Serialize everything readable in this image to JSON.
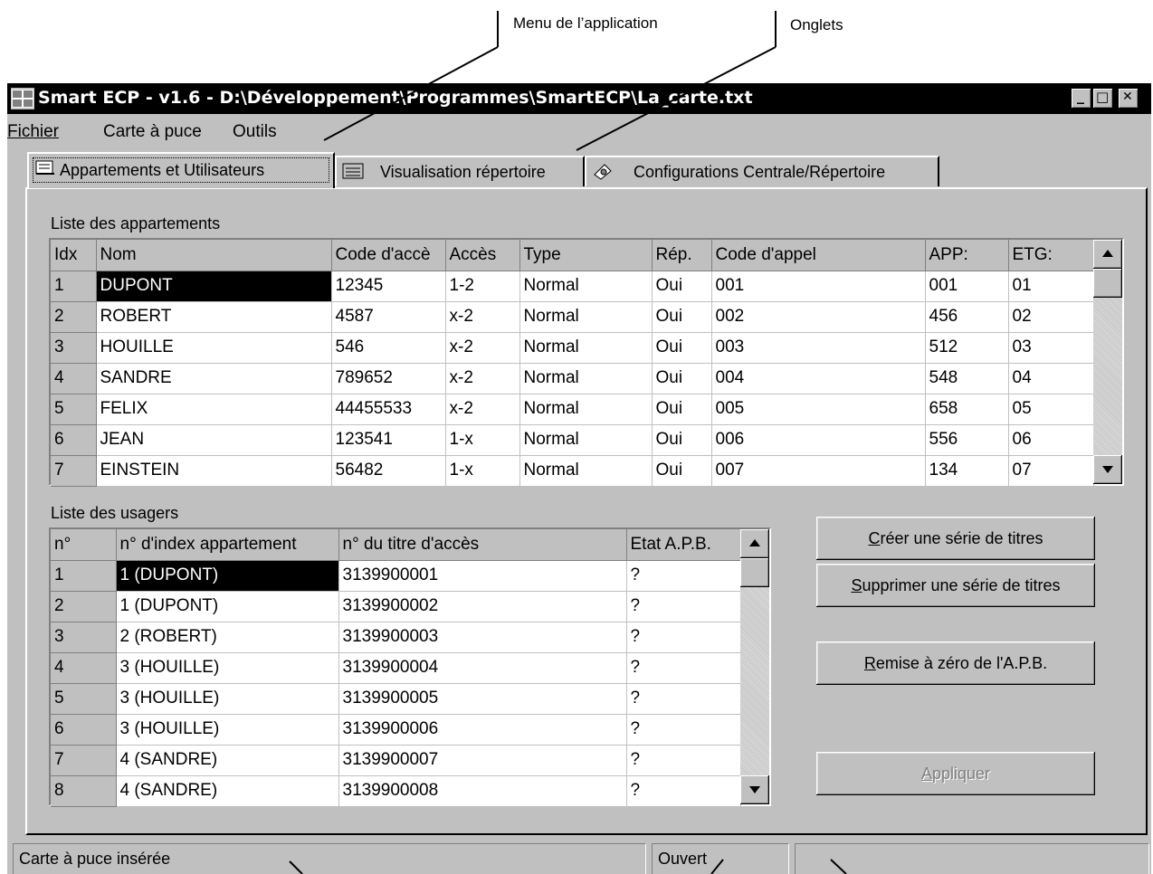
{
  "annotations": {
    "menu_label": "Menu de l’application",
    "tabs_label": "Onglets"
  },
  "window": {
    "title": "Smart ECP - v1.6 - D:\\Développement\\Programmes\\SmartECP\\La_carte.txt",
    "minimize": "_",
    "maximize": "□",
    "close": "✕"
  },
  "menu": [
    "Fichier",
    "Carte à puce",
    "Outils"
  ],
  "tabs": [
    {
      "label": "Appartements et Utilisateurs",
      "icon": "book-icon"
    },
    {
      "label": "Visualisation répertoire",
      "icon": "directory-icon"
    },
    {
      "label": "Configurations Centrale/Répertoire",
      "icon": "config-icon"
    }
  ],
  "apartments": {
    "title": "Liste des appartements",
    "columns": [
      "Idx",
      "Nom",
      "Code d'accè",
      "Accès",
      "Type",
      "Rép.",
      "Code d'appel",
      "APP:",
      "ETG:"
    ],
    "rows": [
      [
        "1",
        "DUPONT",
        "12345",
        "1-2",
        "Normal",
        "Oui",
        "001",
        "001",
        "01"
      ],
      [
        "2",
        "ROBERT",
        "4587",
        "x-2",
        "Normal",
        "Oui",
        "002",
        "456",
        "02"
      ],
      [
        "3",
        "HOUILLE",
        "546",
        "x-2",
        "Normal",
        "Oui",
        "003",
        "512",
        "03"
      ],
      [
        "4",
        "SANDRE",
        "789652",
        "x-2",
        "Normal",
        "Oui",
        "004",
        "548",
        "04"
      ],
      [
        "5",
        "FELIX",
        "44455533",
        "x-2",
        "Normal",
        "Oui",
        "005",
        "658",
        "05"
      ],
      [
        "6",
        "JEAN",
        "123541",
        "1-x",
        "Normal",
        "Oui",
        "006",
        "556",
        "06"
      ],
      [
        "7",
        "EINSTEIN",
        "56482",
        "1-x",
        "Normal",
        "Oui",
        "007",
        "134",
        "07"
      ]
    ]
  },
  "users": {
    "title": "Liste des usagers",
    "columns": [
      "n°",
      "n° d'index appartement",
      "n° du titre d'accès",
      "Etat A.P.B."
    ],
    "rows": [
      [
        "1",
        "1 (DUPONT)",
        "3139900001",
        "?"
      ],
      [
        "2",
        "1 (DUPONT)",
        "3139900002",
        "?"
      ],
      [
        "3",
        "2 (ROBERT)",
        "3139900003",
        "?"
      ],
      [
        "4",
        "3 (HOUILLE)",
        "3139900004",
        "?"
      ],
      [
        "5",
        "3 (HOUILLE)",
        "3139900005",
        "?"
      ],
      [
        "6",
        "3 (HOUILLE)",
        "3139900006",
        "?"
      ],
      [
        "7",
        "4 (SANDRE)",
        "3139900007",
        "?"
      ],
      [
        "8",
        "4 (SANDRE)",
        "3139900008",
        "?"
      ]
    ]
  },
  "buttons": {
    "create": {
      "accel": "C",
      "rest": "réer une série de titres"
    },
    "delete": {
      "accel": "S",
      "rest": "upprimer une série de titres"
    },
    "reset": {
      "accel": "R",
      "rest": "emise à zéro de l'A.P.B."
    },
    "apply": {
      "accel": "A",
      "rest": "ppliquer"
    }
  },
  "status": {
    "card": "Carte à puce insérée",
    "state": "Ouvert",
    "extra": ""
  },
  "colors": {
    "window_bg": "#c0c0c0",
    "titlebar": "#000000",
    "selection": "#000000"
  }
}
